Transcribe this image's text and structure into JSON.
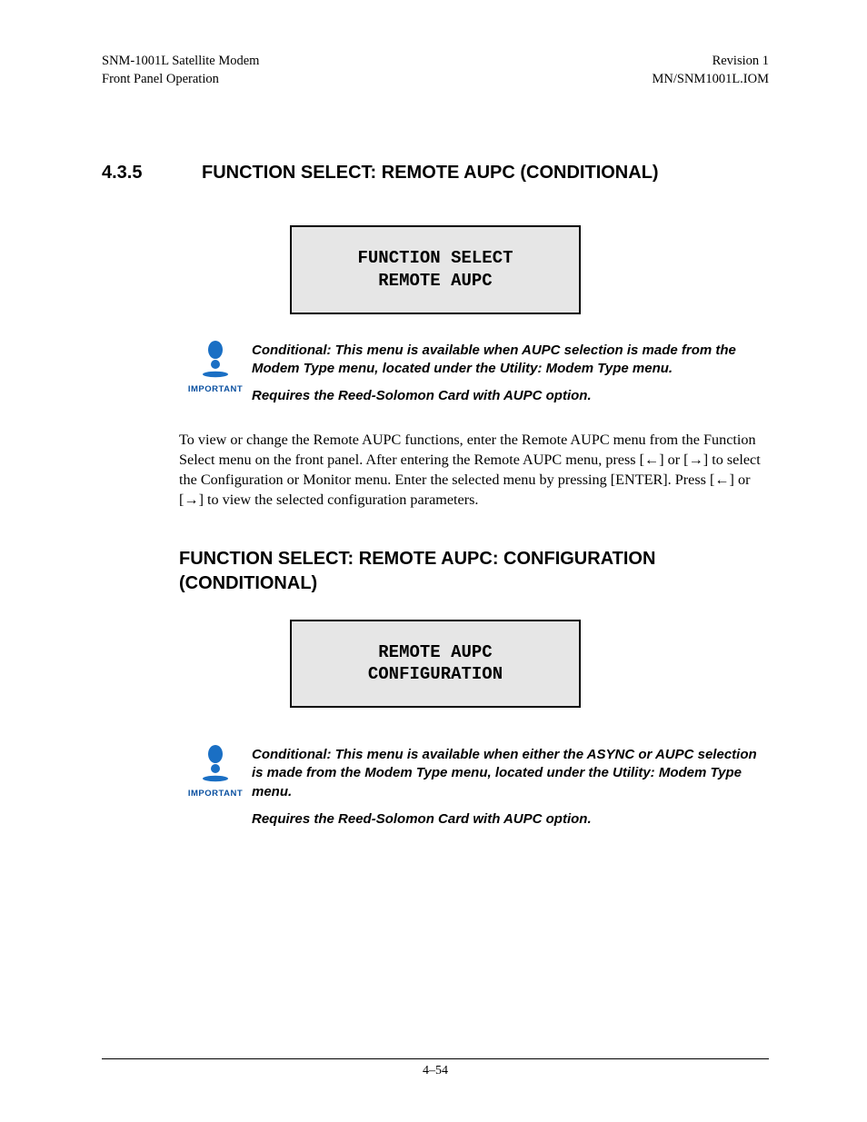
{
  "header": {
    "left_line1": "SNM-1001L Satellite Modem",
    "left_line2": "Front Panel Operation",
    "right_line1": "Revision 1",
    "right_line2": "MN/SNM1001L.IOM"
  },
  "section": {
    "number": "4.3.5",
    "title": "FUNCTION SELECT: REMOTE AUPC (CONDITIONAL)"
  },
  "lcd1": {
    "line1": "FUNCTION SELECT",
    "line2": "REMOTE AUPC"
  },
  "note1": {
    "label": "IMPORTANT",
    "p1": "Conditional: This menu is available when AUPC selection is made from the Modem Type menu, located under the Utility: Modem Type menu.",
    "p2": "Requires the Reed-Solomon Card with AUPC option."
  },
  "body": {
    "p1": "To view or change the Remote AUPC functions, enter the Remote AUPC menu from the Function Select menu on the front panel. After entering the Remote AUPC menu, press [←] or [→] to select the Configuration or Monitor menu. Enter the selected menu by pressing [ENTER]. Press [←] or [→] to view the selected configuration parameters."
  },
  "subheading": {
    "title": "FUNCTION SELECT: REMOTE AUPC: CONFIGURATION (CONDITIONAL)"
  },
  "lcd2": {
    "line1": "REMOTE AUPC",
    "line2": "CONFIGURATION"
  },
  "note2": {
    "label": "IMPORTANT",
    "p1": "Conditional: This menu is available when either the ASYNC or AUPC selection is made from the Modem Type menu, located under the Utility: Modem Type menu.",
    "p2": "Requires the Reed-Solomon Card with AUPC option."
  },
  "footer": {
    "page": "4–54"
  }
}
